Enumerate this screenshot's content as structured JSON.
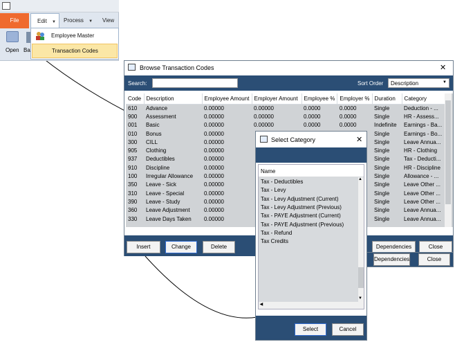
{
  "ribbon": {
    "file_tab": "File",
    "edit_tab": "Edit",
    "process_tab": "Process",
    "view_tab": "View",
    "open_label": "Open",
    "ba_label": "Ba"
  },
  "dropdown": {
    "items": [
      {
        "label": "Employee Master"
      },
      {
        "label": "Transaction Codes"
      }
    ]
  },
  "browse": {
    "title": "Browse Transaction Codes",
    "search_label": "Search:",
    "search_value": "",
    "sort_label": "Sort Order",
    "sort_value": "Description",
    "columns": [
      "Code",
      "Description",
      "Employee Amount",
      "Employer Amount",
      "Employee %",
      "Employer %",
      "Duration",
      "Category"
    ],
    "rows": [
      [
        "610",
        "Advance",
        "0.00000",
        "0.00000",
        "0.0000",
        "0.0000",
        "Single",
        "Deduction - ..."
      ],
      [
        "900",
        "Assessment",
        "0.00000",
        "0.00000",
        "0.0000",
        "0.0000",
        "Single",
        "HR - Assess..."
      ],
      [
        "001",
        "Basic",
        "0.00000",
        "0.00000",
        "0.0000",
        "0.0000",
        "Indefinite",
        "Earnings - Ba..."
      ],
      [
        "010",
        "Bonus",
        "0.00000",
        "",
        "",
        "",
        "Single",
        "Earnings - Bo..."
      ],
      [
        "300",
        "CILL",
        "0.00000",
        "",
        "",
        "",
        "Single",
        "Leave Annua..."
      ],
      [
        "905",
        "Clothing",
        "0.00000",
        "",
        "",
        "",
        "Single",
        "HR - Clothing"
      ],
      [
        "937",
        "Deductibles",
        "0.00000",
        "",
        "",
        "",
        "Single",
        "Tax - Deducti..."
      ],
      [
        "910",
        "Discipline",
        "0.00000",
        "",
        "",
        "",
        "Single",
        "HR - Discipline"
      ],
      [
        "100",
        "Irregular Allowance",
        "0.00000",
        "",
        "",
        "",
        "Single",
        "Allowance - ..."
      ],
      [
        "350",
        "Leave - Sick",
        "0.00000",
        "",
        "",
        "",
        "Single",
        "Leave Other ..."
      ],
      [
        "310",
        "Leave - Special",
        "0.00000",
        "",
        "",
        "",
        "Single",
        "Leave Other ..."
      ],
      [
        "390",
        "Leave - Study",
        "0.00000",
        "",
        "",
        "",
        "Single",
        "Leave Other ..."
      ],
      [
        "360",
        "Leave Adjustment",
        "0.00000",
        "",
        "",
        "",
        "Single",
        "Leave Annua..."
      ],
      [
        "330",
        "Leave Days Taken",
        "0.00000",
        "",
        "",
        "",
        "Single",
        "Leave Annua..."
      ]
    ],
    "buttons": {
      "insert": "Insert",
      "change": "Change",
      "delete": "Delete",
      "dependencies": "Dependencies",
      "close": "Close"
    }
  },
  "browse_behind": {
    "dependencies": "Dependencies",
    "close": "Close"
  },
  "select_category": {
    "title": "Select Category",
    "column": "Name",
    "items": [
      "Tax - Deductibles",
      "Tax - Levy",
      "Tax - Levy Adjustment (Current)",
      "Tax - Levy Adjustment (Previous)",
      "Tax - PAYE Adjustment (Current)",
      "Tax - PAYE Adjustment (Previous)",
      "Tax - Refund",
      "Tax Credits"
    ],
    "select_button": "Select",
    "cancel_button": "Cancel"
  },
  "colors": {
    "accent_bar": "#2b4e75",
    "file_tab": "#ef6a2e",
    "menu_highlight": "#fbe7a6"
  }
}
